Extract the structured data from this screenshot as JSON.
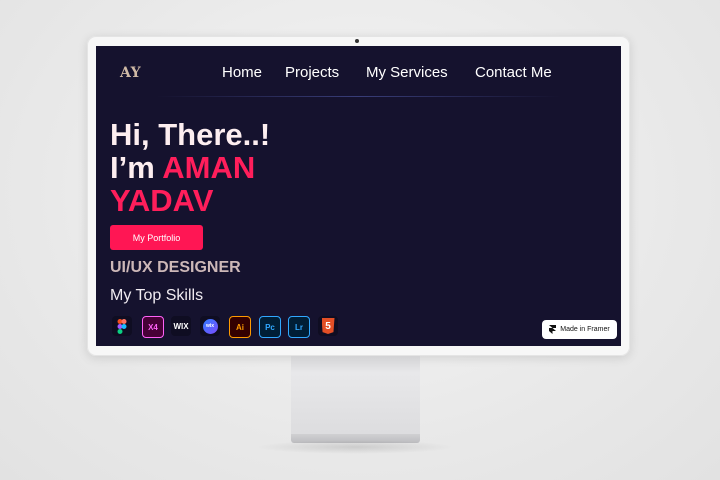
{
  "nav": {
    "logo": "AY",
    "links": [
      "Home",
      "Projects",
      "My Services",
      "Contact Me"
    ]
  },
  "hero": {
    "line1": "Hi, There..!",
    "prefix": "I’m",
    "name_first": "AMAN",
    "name_last": "YADAV",
    "button": "My Portfolio",
    "role": "UI/UX DESIGNER",
    "skills_title": "My Top Skills"
  },
  "skills": [
    {
      "icon": "figma-icon",
      "label": ""
    },
    {
      "icon": "xd-icon",
      "label": "X4"
    },
    {
      "icon": "wix-icon",
      "label": "WIX"
    },
    {
      "icon": "webflow-icon",
      "label": "wix"
    },
    {
      "icon": "illustrator-icon",
      "label": "Ai"
    },
    {
      "icon": "photoshop-icon",
      "label": "Pc"
    },
    {
      "icon": "lightroom-icon",
      "label": "Lr"
    },
    {
      "icon": "html5-icon",
      "label": "5"
    }
  ],
  "badge": {
    "label": "Made in Framer"
  },
  "colors": {
    "background": "#15122e",
    "accent": "#ff1654",
    "logo": "#cfb9a5"
  }
}
